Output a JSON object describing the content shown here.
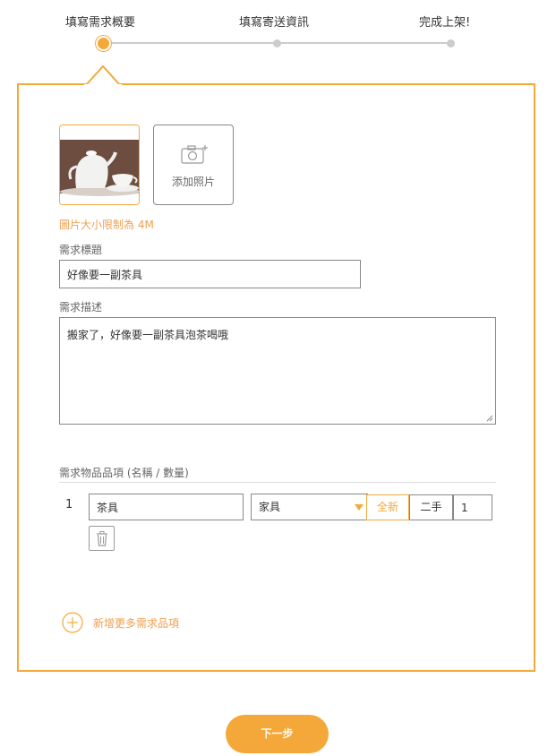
{
  "steps": [
    {
      "label": "填寫需求概要",
      "active": true
    },
    {
      "label": "填寫寄送資訊",
      "active": false
    },
    {
      "label": "完成上架!",
      "active": false
    }
  ],
  "photos": {
    "add_label": "添加照片",
    "size_note": "圖片大小限制為 4M"
  },
  "title_field": {
    "label": "需求標題",
    "value": "好像要一副茶具"
  },
  "desc_field": {
    "label": "需求描述",
    "value": "搬家了，好像要一副茶具泡茶喝哦"
  },
  "items_section": {
    "header": "需求物品品項 (名稱 / 數量)",
    "items": [
      {
        "index": "1",
        "name": "茶具",
        "category": "家具",
        "condition_new": "全新",
        "condition_used": "二手",
        "quantity": "1"
      }
    ],
    "add_more_label": "新增更多需求品項"
  },
  "next_button": "下一步",
  "colors": {
    "accent": "#f5a83a",
    "note": "#f0a050"
  }
}
